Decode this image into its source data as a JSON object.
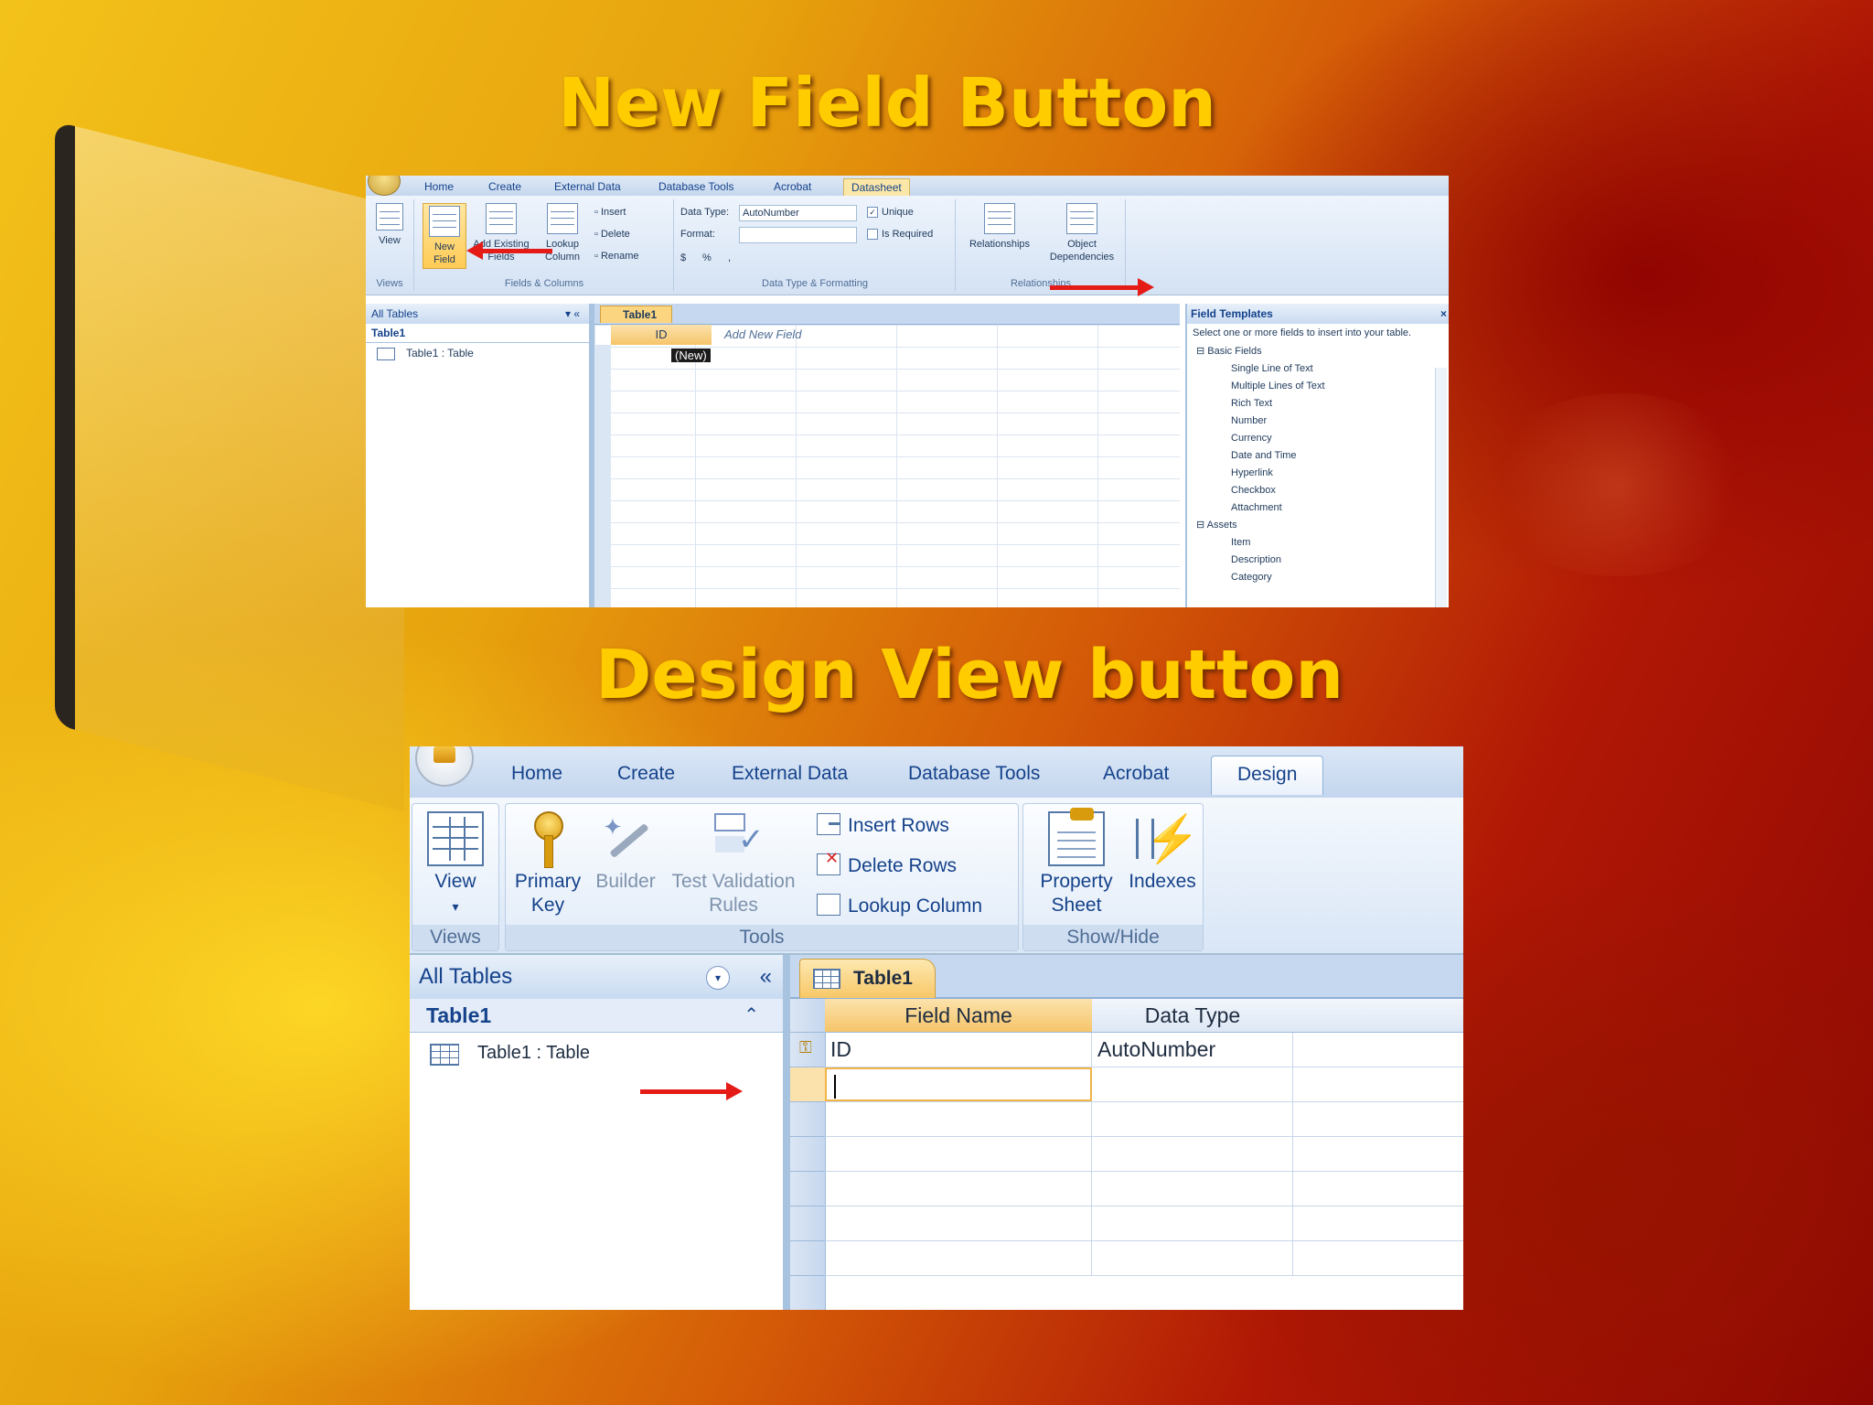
{
  "titles": {
    "top": "New Field Button",
    "bottom": "Design View button"
  },
  "shot1": {
    "tabs": [
      "Home",
      "Create",
      "External Data",
      "Database Tools",
      "Acrobat",
      "Datasheet"
    ],
    "active_tab": "Datasheet",
    "views": {
      "view": "View",
      "group": "Views"
    },
    "fields_columns": {
      "new_field": "New Field",
      "add_existing": "Add Existing Fields",
      "lookup_column": "Lookup Column",
      "insert": "Insert",
      "delete": "Delete",
      "rename": "Rename",
      "group": "Fields & Columns"
    },
    "data_type_formatting": {
      "data_type_label": "Data Type:",
      "data_type_value": "AutoNumber",
      "format_label": "Format:",
      "format_value": "",
      "unique": "Unique",
      "is_required": "Is Required",
      "currency": "$",
      "percent": "%",
      "comma": ",",
      "group": "Data Type & Formatting"
    },
    "relationships": {
      "relationships": "Relationships",
      "object_dependencies": "Object Dependencies",
      "group": "Relationships"
    },
    "nav": {
      "header": "All Tables",
      "group": "Table1",
      "item": "Table1 : Table"
    },
    "document_tab": "Table1",
    "grid": {
      "col_id": "ID",
      "col_add": "Add New Field",
      "new_cell": "(New)"
    },
    "field_templates": {
      "title": "Field Templates",
      "description": "Select one or more fields to insert into your table.",
      "group_basic": "Basic Fields",
      "basic_items": [
        "Single Line of Text",
        "Multiple Lines of Text",
        "Rich Text",
        "Number",
        "Currency",
        "Date and Time",
        "Hyperlink",
        "Checkbox",
        "Attachment"
      ],
      "group_assets": "Assets",
      "asset_items": [
        "Item",
        "Description",
        "Category"
      ]
    }
  },
  "shot2": {
    "tabs": [
      "Home",
      "Create",
      "External Data",
      "Database Tools",
      "Acrobat",
      "Design"
    ],
    "active_tab": "Design",
    "views": {
      "view": "View",
      "group": "Views"
    },
    "tools": {
      "primary_key_1": "Primary",
      "primary_key_2": "Key",
      "builder": "Builder",
      "test_validation_1": "Test Validation",
      "test_validation_2": "Rules",
      "insert_rows": "Insert Rows",
      "delete_rows": "Delete Rows",
      "lookup_column": "Lookup Column",
      "group": "Tools"
    },
    "show_hide": {
      "property_sheet_1": "Property",
      "property_sheet_2": "Sheet",
      "indexes": "Indexes",
      "group": "Show/Hide"
    },
    "nav": {
      "header": "All Tables",
      "collapse": "«",
      "group": "Table1",
      "item": "Table1 : Table"
    },
    "document_tab": "Table1",
    "grid": {
      "col_field_name": "Field Name",
      "col_data_type": "Data Type",
      "rows": [
        {
          "field": "ID",
          "type": "AutoNumber"
        }
      ]
    }
  }
}
